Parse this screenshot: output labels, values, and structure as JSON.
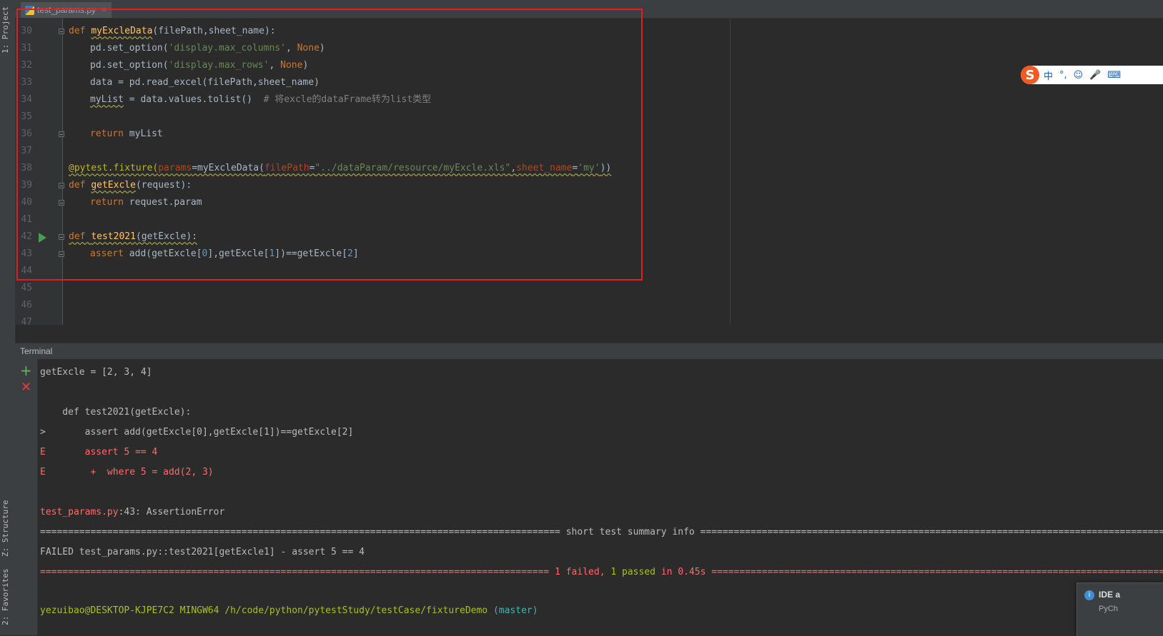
{
  "tool_strip": {
    "project": "1: Project",
    "structure": "Z: Structure",
    "favorites": "2: Favorites"
  },
  "editor": {
    "tab": {
      "filename": "test_params.py",
      "close": "×"
    },
    "gutter": [
      "30",
      "31",
      "32",
      "33",
      "34",
      "35",
      "36",
      "37",
      "38",
      "39",
      "40",
      "41",
      "42",
      "43",
      "44",
      "45",
      "46",
      "47"
    ],
    "code": {
      "l30": {
        "kw": "def ",
        "fn": "myExcleData",
        "rest": "(filePath,sheet_name):"
      },
      "l31": {
        "a": "pd.set_option(",
        "s": "'display.max_columns'",
        "b": ", ",
        "k": "None",
        "c": ")"
      },
      "l32": {
        "a": "pd.set_option(",
        "s": "'display.max_rows'",
        "b": ", ",
        "k": "None",
        "c": ")"
      },
      "l33": {
        "a": "data = pd.read_excel(filePath,sheet_name)"
      },
      "l34": {
        "a": "myList",
        "b": " = data.values.tolist()  ",
        "c": "# 将excle的dataFrame转为list类型"
      },
      "l36": {
        "k": "return ",
        "a": "myList"
      },
      "l38": {
        "d": "@pytest.fixture(",
        "p1": "params",
        "e": "=myExcleData(",
        "p2": "filePath",
        "f": "=",
        "s1": "\"../dataParam/resource/myExcle.xls\"",
        "g": ",",
        "p3": "sheet_name",
        "h": "=",
        "s2": "'my'",
        "i": "))"
      },
      "l39": {
        "kw": "def ",
        "fn": "getExcle",
        "rest": "(request):"
      },
      "l40": {
        "k": "return ",
        "a": "request.param"
      },
      "l42": {
        "kw": "def ",
        "fn": "test2021",
        "rest": "(getExcle):"
      },
      "l43": {
        "k": "assert ",
        "a": "add(getExcle[",
        "n1": "0",
        "b": "],getExcle[",
        "n2": "1",
        "c": "])==getExcle[",
        "n3": "2",
        "d": "]"
      }
    }
  },
  "terminal": {
    "title": "Terminal",
    "add_icon": "+",
    "close_icon": "✕",
    "lines": {
      "t1": "getExcle = [2, 3, 4]",
      "t2": "    def test2021(getExcle):",
      "t3": ">       assert add(getExcle[0],getExcle[1])==getExcle[2]",
      "t4": "E       assert 5 == 4",
      "t5": "E        +  where 5 = add(2, 3)",
      "t6_file": "test_params.py",
      "t6_rest": ":43: AssertionError",
      "t7": "============================================================================================= short test summary info ==============================================================================================",
      "t8": "FAILED test_params.py::test2021[getExcle1] - assert 5 == 4",
      "t9_a": "=========================================================================================== ",
      "t9_b": "1 failed",
      "t9_c": ", ",
      "t9_d": "1 passed",
      "t9_e": " in 0.45s",
      "t9_f": " ================================================================================================",
      "t10_a": "yezuibao@DESKTOP-KJPE7C2 MINGW64 /h/code/python/pytestStudy/testCase/fixtureDemo ",
      "t10_b": "(master)"
    }
  },
  "ime": {
    "logo": "S",
    "items": [
      "中",
      "°,",
      "☺",
      "🎤",
      "⌨"
    ]
  },
  "notification": {
    "title": "IDE a",
    "subtitle": "PyCh"
  }
}
